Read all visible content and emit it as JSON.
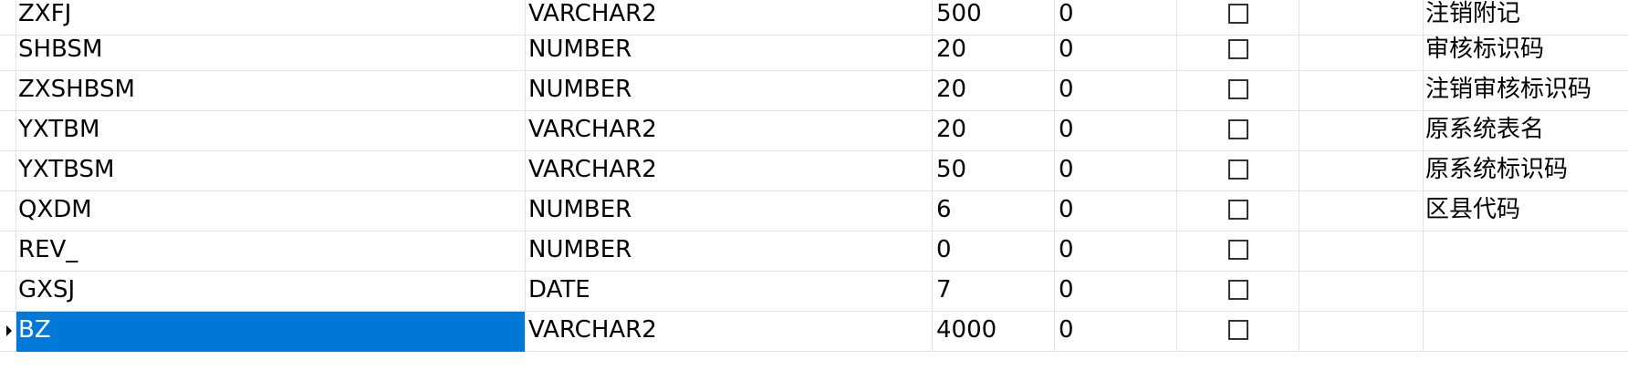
{
  "rows": [
    {
      "name": "ZXFJ",
      "type": "VARCHAR2",
      "length": "500",
      "scale": "0",
      "not_null": false,
      "comment": "注销附记"
    },
    {
      "name": "SHBSM",
      "type": "NUMBER",
      "length": "20",
      "scale": "0",
      "not_null": false,
      "comment": "审核标识码"
    },
    {
      "name": "ZXSHBSM",
      "type": "NUMBER",
      "length": "20",
      "scale": "0",
      "not_null": false,
      "comment": "注销审核标识码"
    },
    {
      "name": "YXTBM",
      "type": "VARCHAR2",
      "length": "20",
      "scale": "0",
      "not_null": false,
      "comment": "原系统表名"
    },
    {
      "name": "YXTBSM",
      "type": "VARCHAR2",
      "length": "50",
      "scale": "0",
      "not_null": false,
      "comment": "原系统标识码"
    },
    {
      "name": "QXDM",
      "type": "NUMBER",
      "length": "6",
      "scale": "0",
      "not_null": false,
      "comment": "区县代码"
    },
    {
      "name": "REV_",
      "type": "NUMBER",
      "length": "0",
      "scale": "0",
      "not_null": false,
      "comment": ""
    },
    {
      "name": "GXSJ",
      "type": "DATE",
      "length": "7",
      "scale": "0",
      "not_null": false,
      "comment": ""
    },
    {
      "name": "BZ",
      "type": "VARCHAR2",
      "length": "4000",
      "scale": "0",
      "not_null": false,
      "comment": ""
    }
  ],
  "selected_row_index": 8,
  "colors": {
    "selection": "#0078d7",
    "gridline": "#e3e3e3"
  }
}
